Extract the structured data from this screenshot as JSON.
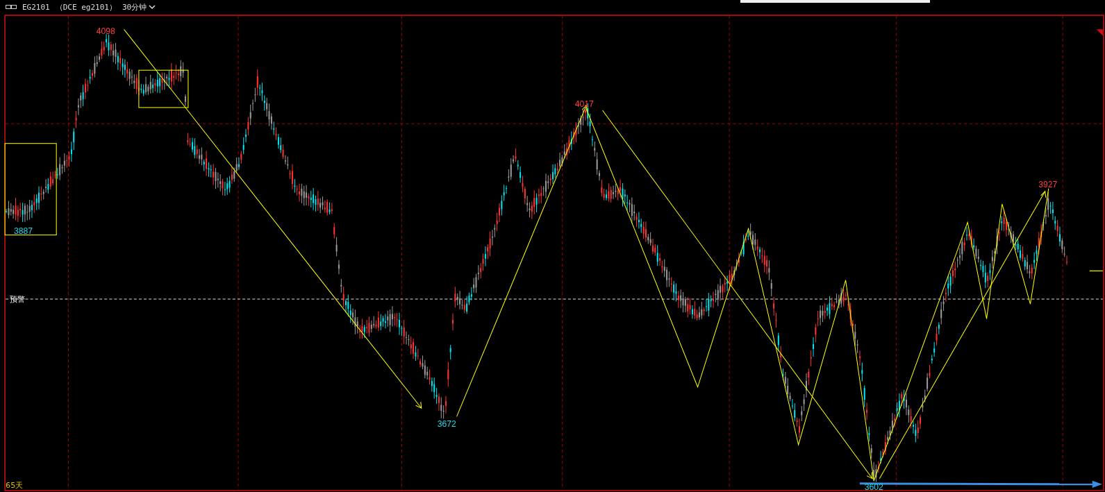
{
  "header": {
    "symbol": "EG2101",
    "contract": "（DCE eg2101）",
    "period": "30分钟"
  },
  "chart": {
    "price_labels": [
      {
        "text": "4098",
        "kind": "high"
      },
      {
        "text": "3887",
        "kind": "low"
      },
      {
        "text": "3672",
        "kind": "low"
      },
      {
        "text": "4017",
        "kind": "high"
      },
      {
        "text": "3927",
        "kind": "high"
      },
      {
        "text": "3602",
        "kind": "low"
      }
    ],
    "alert_label": "预警",
    "day_count": "65天"
  }
}
